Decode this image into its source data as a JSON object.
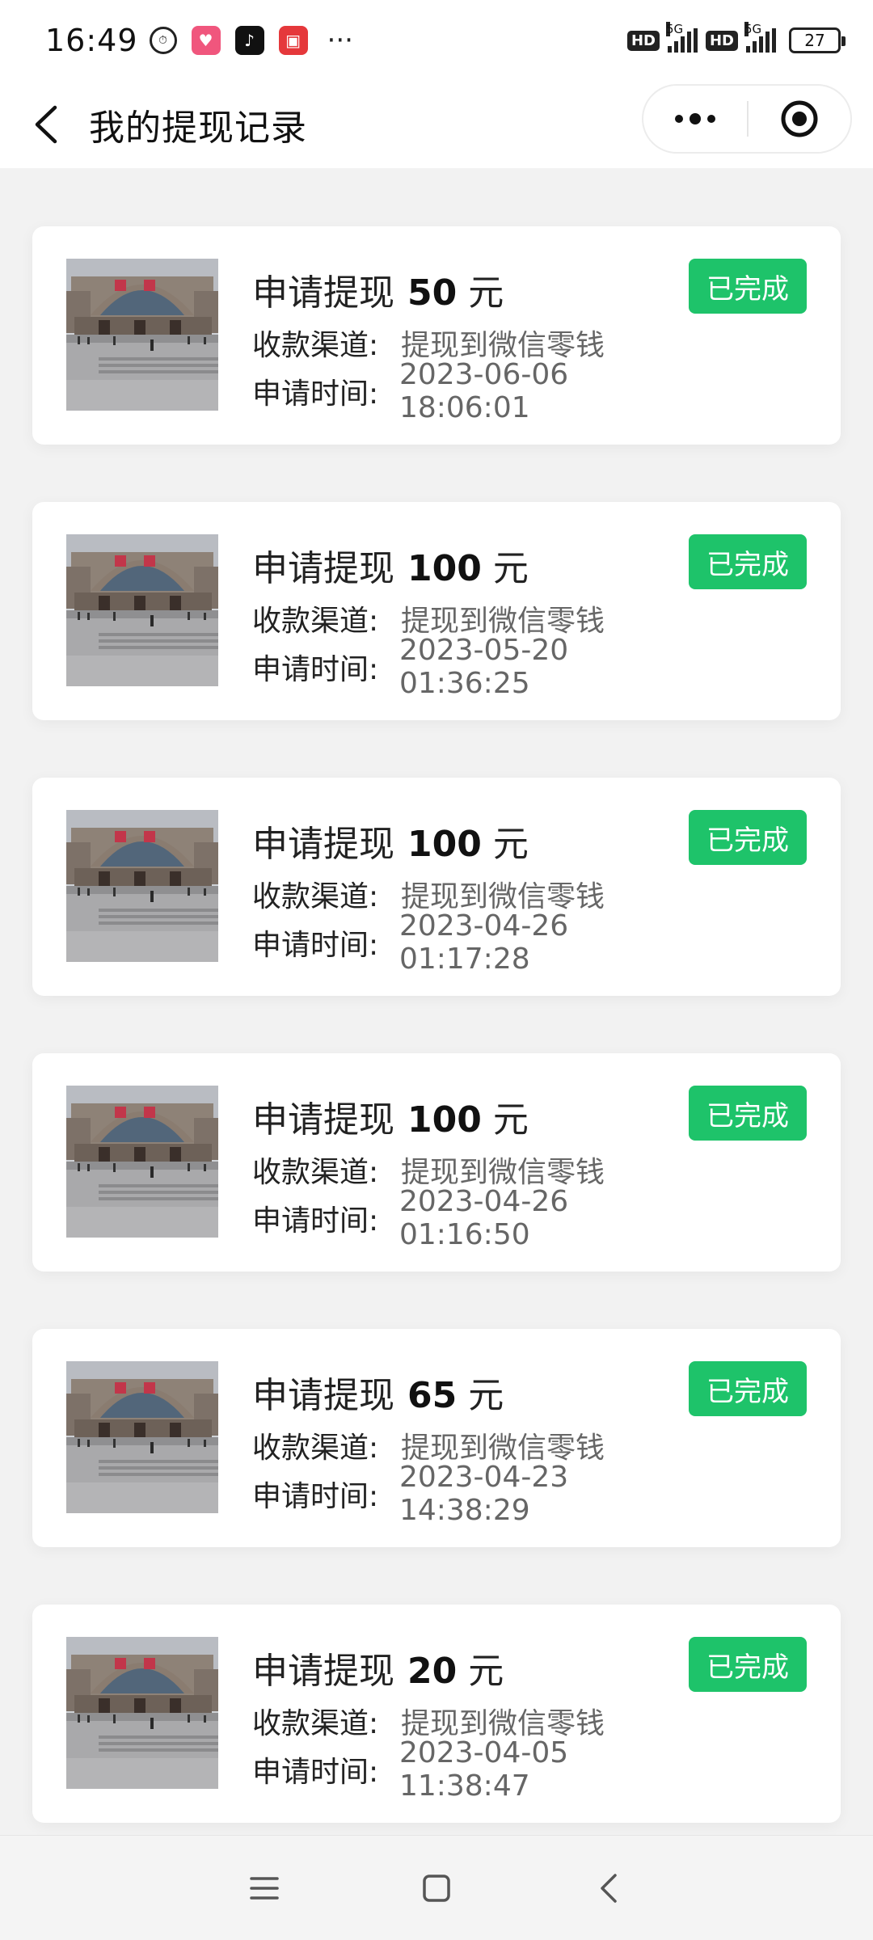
{
  "status_bar": {
    "time": "16:49",
    "more": "···",
    "hd1": "HD",
    "net1": "5G",
    "hd2": "HD",
    "net2": "5G",
    "battery": "27"
  },
  "nav": {
    "title": "我的提现记录"
  },
  "records": [
    {
      "label": "申请提现",
      "amount": "50",
      "unit": "元",
      "status": "已完成",
      "channel_label": "收款渠道:",
      "channel_value": "提现到微信零钱",
      "time_label": "申请时间:",
      "time_value": "2023-06-06 18:06:01"
    },
    {
      "label": "申请提现",
      "amount": "100",
      "unit": "元",
      "status": "已完成",
      "channel_label": "收款渠道:",
      "channel_value": "提现到微信零钱",
      "time_label": "申请时间:",
      "time_value": "2023-05-20 01:36:25"
    },
    {
      "label": "申请提现",
      "amount": "100",
      "unit": "元",
      "status": "已完成",
      "channel_label": "收款渠道:",
      "channel_value": "提现到微信零钱",
      "time_label": "申请时间:",
      "time_value": "2023-04-26 01:17:28"
    },
    {
      "label": "申请提现",
      "amount": "100",
      "unit": "元",
      "status": "已完成",
      "channel_label": "收款渠道:",
      "channel_value": "提现到微信零钱",
      "time_label": "申请时间:",
      "time_value": "2023-04-26 01:16:50"
    },
    {
      "label": "申请提现",
      "amount": "65",
      "unit": "元",
      "status": "已完成",
      "channel_label": "收款渠道:",
      "channel_value": "提现到微信零钱",
      "time_label": "申请时间:",
      "time_value": "2023-04-23 14:38:29"
    },
    {
      "label": "申请提现",
      "amount": "20",
      "unit": "元",
      "status": "已完成",
      "channel_label": "收款渠道:",
      "channel_value": "提现到微信零钱",
      "time_label": "申请时间:",
      "time_value": "2023-04-05 11:38:47"
    }
  ],
  "colors": {
    "status_badge": "#1ec36a",
    "background": "#f2f2f2"
  }
}
